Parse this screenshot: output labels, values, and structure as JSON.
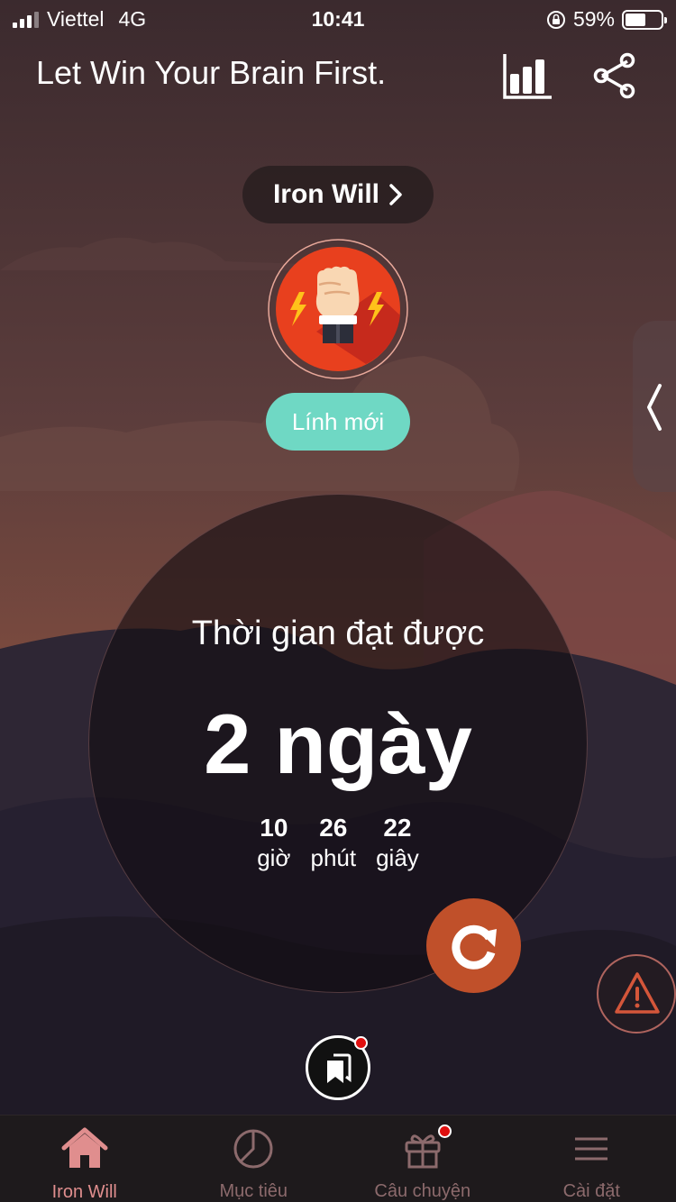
{
  "status_bar": {
    "carrier": "Viettel",
    "network": "4G",
    "time": "10:41",
    "battery_percent": "59%",
    "battery_level": 0.59
  },
  "header": {
    "title": "Let Win Your Brain First.",
    "stats_icon": "bar-chart-icon",
    "share_icon": "share-icon"
  },
  "challenge": {
    "name": "Iron Will",
    "rank": "Lính mới",
    "avatar_icon": "raised-fist-lightning-icon"
  },
  "timer": {
    "label": "Thời gian đạt được",
    "main": "2 ngày",
    "units": [
      {
        "value": "10",
        "label": "giờ"
      },
      {
        "value": "26",
        "label": "phút"
      },
      {
        "value": "22",
        "label": "giây"
      }
    ]
  },
  "actions": {
    "reset_icon": "refresh-icon",
    "warning_icon": "warning-icon",
    "bookmark_icon": "bookmarks-icon"
  },
  "bottom_nav": [
    {
      "label": "Iron Will",
      "icon": "home-icon",
      "active": true
    },
    {
      "label": "Mục tiêu",
      "icon": "pie-chart-icon",
      "active": false
    },
    {
      "label": "Câu chuyện",
      "icon": "gift-icon",
      "active": false,
      "badge": true
    },
    {
      "label": "Cài đặt",
      "icon": "menu-icon",
      "active": false
    }
  ],
  "colors": {
    "accent": "#c0502a",
    "rank": "#6fd8c4",
    "active_tab": "#e08e8e",
    "inactive_tab": "#8c6a6c",
    "alert": "#e01010"
  }
}
